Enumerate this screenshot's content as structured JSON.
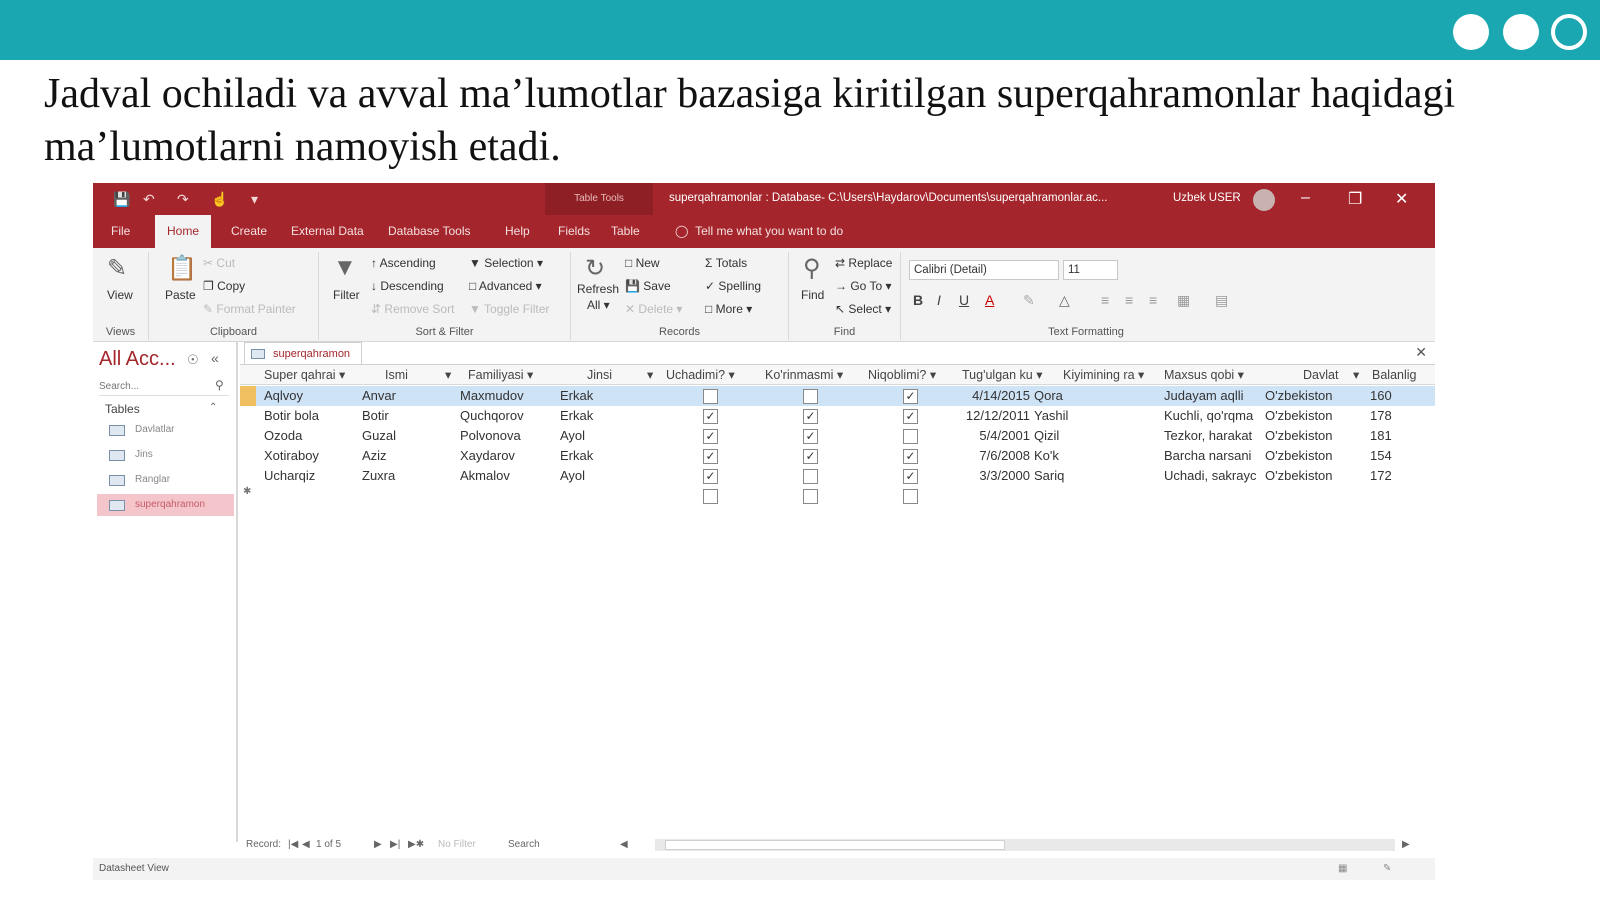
{
  "slide": {
    "caption": "Jadval ochiladi va avval ma’lumotlar bazasiga kiritilgan superqahramonlar haqidagi ma’lumotlarni namoyish etadi."
  },
  "window": {
    "context_tab": "Table Tools",
    "title": "superqahramonlar : Database- C:\\Users\\Haydarov\\Documents\\superqahramonlar.ac...",
    "user": "Uzbek USER"
  },
  "ribbon_tabs": [
    "File",
    "Home",
    "Create",
    "External Data",
    "Database Tools",
    "Help",
    "Fields",
    "Table"
  ],
  "tell_me": "Tell me what you want to do",
  "ribbon": {
    "views": {
      "view": "View",
      "group": "Views"
    },
    "clipboard": {
      "paste": "Paste",
      "cut": "Cut",
      "copy": "Copy",
      "format_painter": "Format Painter",
      "group": "Clipboard"
    },
    "sort_filter": {
      "filter": "Filter",
      "ascending": "Ascending",
      "descending": "Descending",
      "remove_sort": "Remove Sort",
      "selection": "Selection",
      "advanced": "Advanced",
      "toggle_filter": "Toggle Filter",
      "group": "Sort & Filter"
    },
    "records": {
      "refresh": "Refresh",
      "refresh_all": "All",
      "new": "New",
      "save": "Save",
      "delete": "Delete",
      "totals": "Totals",
      "spelling": "Spelling",
      "more": "More",
      "group": "Records"
    },
    "find": {
      "find": "Find",
      "replace": "Replace",
      "goto": "Go To",
      "select": "Select",
      "group": "Find"
    },
    "text_formatting": {
      "font": "Calibri (Detail)",
      "size": "11",
      "bold": "B",
      "italic": "I",
      "underline": "U",
      "font_color": "A",
      "group": "Text Formatting"
    }
  },
  "nav": {
    "header": "All Acc...",
    "search_placeholder": "Search...",
    "section": "Tables",
    "items": [
      "Davlatlar",
      "Jins",
      "Ranglar",
      "superqahramon"
    ]
  },
  "document": {
    "tab": "superqahramon",
    "columns": [
      "Super qahrai",
      "Ismi",
      "Familiyasi",
      "Jinsi",
      "Uchadimi?",
      "Ko'rinmasmi",
      "Niqoblimi?",
      "Tug'ulgan ku",
      "Kiyimining ra",
      "Maxsus qobi",
      "Davlat",
      "Balanlig"
    ],
    "rows": [
      {
        "super": "Aqlvoy",
        "ismi": "Anvar",
        "familiya": "Maxmudov",
        "jinsi": "Erkak",
        "uchadi": false,
        "korinmas": false,
        "niqobli": true,
        "tugilgan": "4/14/2015",
        "rang": "Qora",
        "qobiliyat": "Judayam aqlli",
        "davlat": "O'zbekiston",
        "balandlik": "160"
      },
      {
        "super": "Botir bola",
        "ismi": "Botir",
        "familiya": "Quchqorov",
        "jinsi": "Erkak",
        "uchadi": true,
        "korinmas": true,
        "niqobli": true,
        "tugilgan": "12/12/2011",
        "rang": "Yashil",
        "qobiliyat": "Kuchli, qo'rqma",
        "davlat": "O'zbekiston",
        "balandlik": "178"
      },
      {
        "super": "Ozoda",
        "ismi": "Guzal",
        "familiya": "Polvonova",
        "jinsi": "Ayol",
        "uchadi": true,
        "korinmas": true,
        "niqobli": false,
        "tugilgan": "5/4/2001",
        "rang": "Qizil",
        "qobiliyat": "Tezkor, harakat",
        "davlat": "O'zbekiston",
        "balandlik": "181"
      },
      {
        "super": "Xotiraboy",
        "ismi": "Aziz",
        "familiya": "Xaydarov",
        "jinsi": "Erkak",
        "uchadi": true,
        "korinmas": true,
        "niqobli": true,
        "tugilgan": "7/6/2008",
        "rang": "Ko'k",
        "qobiliyat": "Barcha narsani",
        "davlat": "O'zbekiston",
        "balandlik": "154"
      },
      {
        "super": "Ucharqiz",
        "ismi": "Zuxra",
        "familiya": "Akmalov",
        "jinsi": "Ayol",
        "uchadi": true,
        "korinmas": false,
        "niqobli": true,
        "tugilgan": "3/3/2000",
        "rang": "Sariq",
        "qobiliyat": "Uchadi, sakrayc",
        "davlat": "O'zbekiston",
        "balandlik": "172"
      }
    ]
  },
  "statusbar": {
    "record_label": "Record:",
    "record_position": "1 of 5",
    "no_filter": "No Filter",
    "search": "Search",
    "view_name": "Datasheet View"
  },
  "colors": {
    "accent": "#a4262c",
    "slide_bar": "#1aa7b2",
    "row_highlight": "#cfe3f7"
  }
}
